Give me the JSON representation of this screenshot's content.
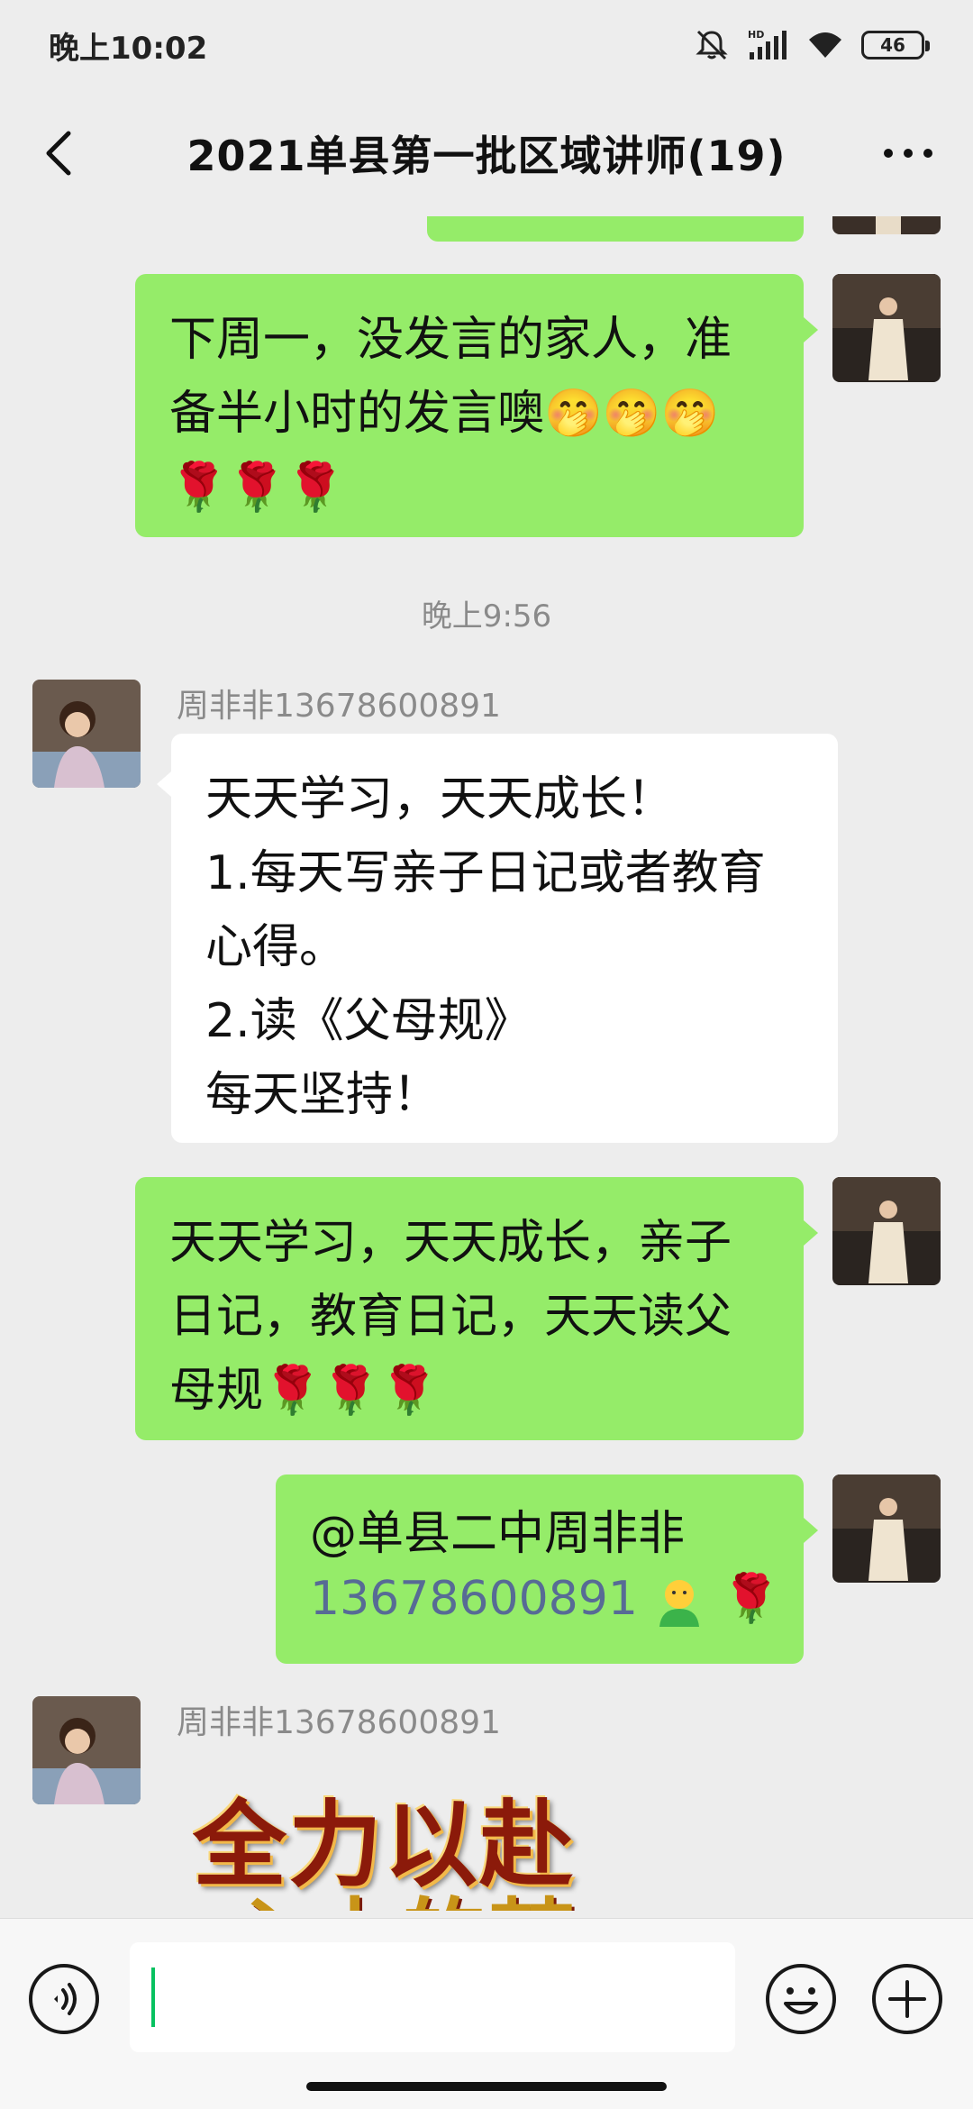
{
  "status_bar": {
    "time": "晚上10:02",
    "network_label": "HD",
    "battery": "46"
  },
  "header": {
    "title": "2021单县第一批区域讲师(19)"
  },
  "messages": [
    {
      "id": "m1",
      "side": "right",
      "lines": [
        "下周一，没发言的家人，准",
        "备半小时的发言噢🤭🤭🤭",
        "🌹🌹🌹"
      ]
    },
    {
      "id": "ts",
      "type": "timestamp",
      "text": "晚上9:56"
    },
    {
      "id": "m2",
      "side": "left",
      "sender": "周非非13678600891",
      "lines": [
        "天天学习，天天成长！",
        "1.每天写亲子日记或者教育",
        "心得。",
        "2.读《父母规》",
        "每天坚持！"
      ]
    },
    {
      "id": "m3",
      "side": "right",
      "lines": [
        "天天学习，天天成长，亲子",
        "日记，教育日记，天天读父",
        "母规🌹🌹🌹"
      ]
    },
    {
      "id": "m4",
      "side": "right",
      "mention_line1": "@单县二中周非非",
      "mention_line2": "13678600891",
      "emoji_tail": "🌹"
    },
    {
      "id": "m5",
      "side": "left",
      "sender": "周非非13678600891",
      "sticker_line1": "全力以赴",
      "sticker_line2": "心中的梦"
    }
  ],
  "icons": {
    "back": "chevron-left-icon",
    "more": "more-dots-icon",
    "voice": "voice-icon",
    "emoji": "emoji-icon",
    "plus": "plus-icon"
  },
  "colors": {
    "bubble_self": "#95ec69",
    "bubble_other": "#ffffff",
    "background": "#ededed",
    "mention": "#576b95",
    "cursor": "#07c160"
  }
}
